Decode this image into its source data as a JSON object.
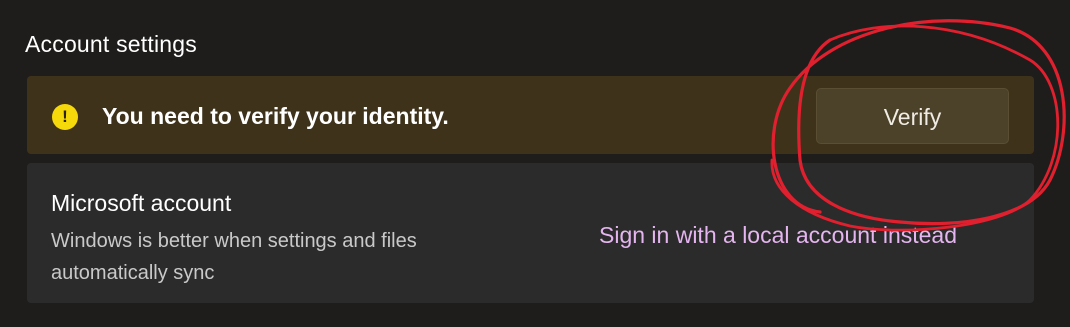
{
  "section": {
    "title": "Account settings"
  },
  "banner": {
    "icon": "warning-icon",
    "icon_glyph": "!",
    "message": "You need to verify your identity.",
    "verify_label": "Verify",
    "background_color": "#3f321b",
    "icon_color": "#f5d90a"
  },
  "account_card": {
    "title": "Microsoft account",
    "description": "Windows is better when settings and files automatically sync",
    "link_label": "Sign in with a local account instead",
    "link_color": "#e4b5ef"
  },
  "annotation": {
    "type": "red hand-drawn circle around Verify button",
    "color": "#e0202e"
  }
}
